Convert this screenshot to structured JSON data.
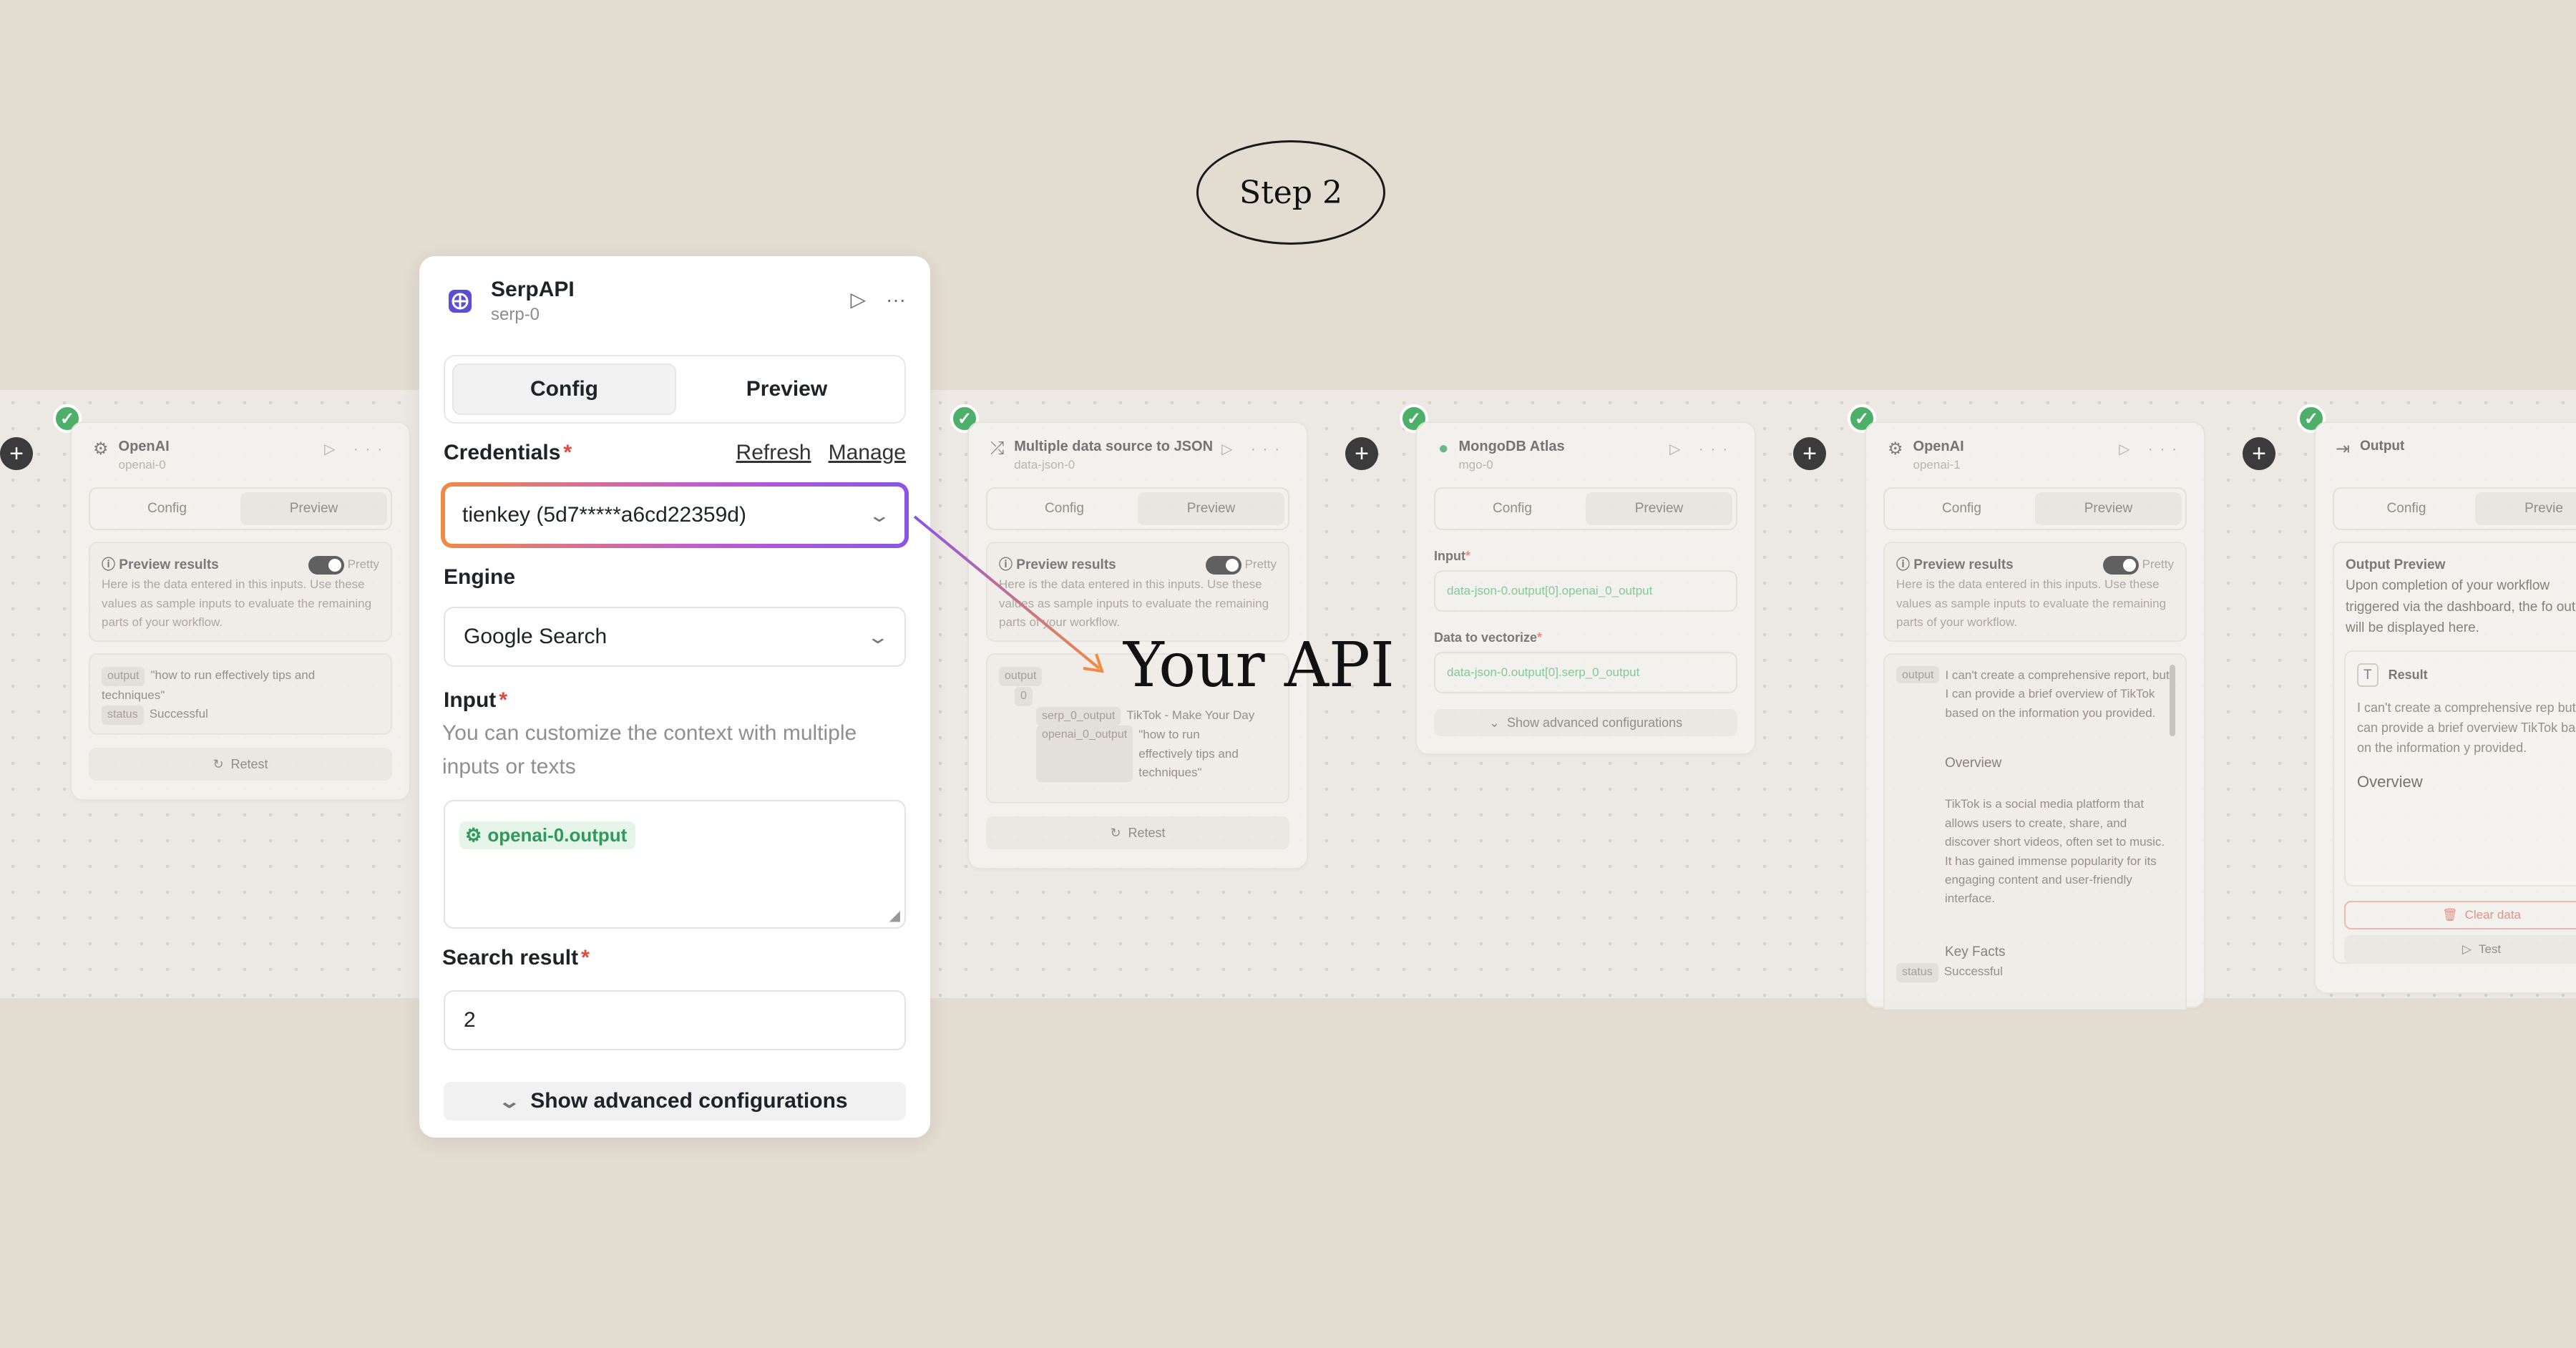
{
  "step_label": "Step 2",
  "annotation_text": "Your API",
  "serp_node": {
    "title": "SerpAPI",
    "subtitle": "serp-0",
    "tabs": [
      "Config",
      "Preview"
    ],
    "credentials": {
      "label": "Credentials",
      "refresh": "Refresh",
      "manage": "Manage",
      "value": "tienkey (5d7*****a6cd22359d)"
    },
    "engine": {
      "label": "Engine",
      "value": "Google Search"
    },
    "input": {
      "label": "Input",
      "help": "You can customize the context with multiple inputs or texts",
      "chip": "openai-0.output"
    },
    "search_result": {
      "label": "Search result",
      "value": "2"
    },
    "advanced_button": "Show advanced configurations"
  },
  "bg_nodes": {
    "openai0": {
      "title": "OpenAI",
      "subtitle": "openai-0",
      "tabs": [
        "Config",
        "Preview"
      ],
      "preview_title": "Preview results",
      "pretty": "Pretty",
      "preview_desc": "Here is the data entered in this inputs. Use these values as sample inputs to evaluate the remaining parts of your workflow.",
      "output_key": "output",
      "output_value": "\"how to run effectively tips and techniques\"",
      "status_key": "status",
      "status_value": "Successful",
      "retest": "Retest"
    },
    "json0": {
      "title": "Multiple data source to JSON",
      "subtitle": "data-json-0",
      "tabs": [
        "Config",
        "Preview"
      ],
      "preview_title": "Preview results",
      "pretty": "Pretty",
      "preview_desc": "Here is the data entered in this inputs. Use these values as sample inputs to evaluate the remaining parts of your workflow.",
      "output_key": "output",
      "index": "0",
      "serp_key": "serp_0_output",
      "serp_value": "TikTok - Make Your Day",
      "openai_key": "openai_0_output",
      "openai_value": "\"how to run effectively tips and techniques\"",
      "retest": "Retest"
    },
    "mongo0": {
      "title": "MongoDB Atlas",
      "subtitle": "mgo-0",
      "tabs": [
        "Config",
        "Preview"
      ],
      "input_label": "Input",
      "input_value": "data-json-0.output[0].openai_0_output",
      "vector_label": "Data to vectorize",
      "vector_value": "data-json-0.output[0].serp_0_output",
      "advanced": "Show advanced configurations"
    },
    "openai1": {
      "title": "OpenAI",
      "subtitle": "openai-1",
      "tabs": [
        "Config",
        "Preview"
      ],
      "preview_title": "Preview results",
      "pretty": "Pretty",
      "preview_desc": "Here is the data entered in this inputs. Use these values as sample inputs to evaluate the remaining parts of your workflow.",
      "output_key": "output",
      "output_text": "I can't create a comprehensive report, but I can provide a brief overview of TikTok based on the information you provided.",
      "overview_heading": "Overview",
      "overview_text": "TikTok is a social media platform that allows users to create, share, and discover short videos, often set to music. It has gained immense popularity for its engaging content and user-friendly interface.",
      "key_facts": "Key Facts",
      "status_key": "status",
      "status_value": "Successful"
    },
    "output": {
      "title": "Output",
      "tabs": [
        "Config",
        "Previe"
      ],
      "preview_title": "Output Preview",
      "preview_desc": "Upon completion of your workflow triggered via the dashboard, the fo output will be displayed here.",
      "result_title": "Result",
      "result_text": "I can't create a comprehensive rep but I can provide a brief overview TikTok based on the information y provided.",
      "overview_heading": "Overview",
      "clear": "Clear data",
      "test": "Test"
    }
  },
  "colors": {
    "background": "#e3dcd1",
    "canvas": "#ece9e4",
    "success": "#4caf6a",
    "highlight_start": "#f08a44",
    "highlight_end": "#8a55e6",
    "chip_green": "#2f9a58"
  }
}
